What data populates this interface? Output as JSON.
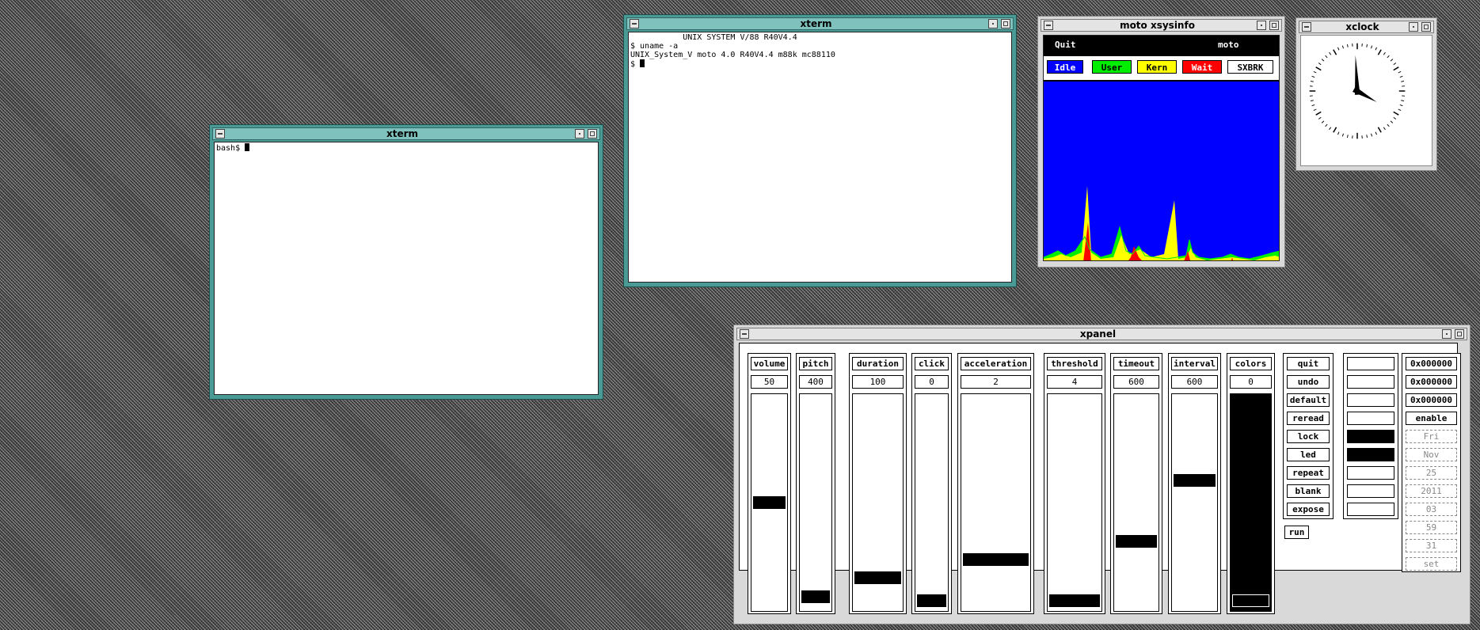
{
  "xterm_left": {
    "title": "xterm",
    "prompt": "bash$ "
  },
  "xterm_right": {
    "title": "xterm",
    "lines": [
      "           UNIX SYSTEM V/88 R40V4.4",
      "$ uname -a",
      "UNIX_System_V moto 4.0 R40V4.4 m88k mc88110",
      "$ "
    ]
  },
  "xsysinfo": {
    "title": "moto xsysinfo",
    "quit": "Quit",
    "host": "moto",
    "legend": [
      {
        "label": "Idle",
        "bg": "#0000ff",
        "fg": "#ffffff"
      },
      {
        "label": "User",
        "bg": "#00ee00",
        "fg": "#000000"
      },
      {
        "label": "Kern",
        "bg": "#ffff00",
        "fg": "#000000"
      },
      {
        "label": "Wait",
        "bg": "#ff0000",
        "fg": "#ffffff"
      },
      {
        "label": "SXBRK",
        "bg": "#ffffff",
        "fg": "#000000"
      }
    ]
  },
  "xclock": {
    "title": "xclock",
    "hours": 3,
    "minutes": 59,
    "seconds": 31
  },
  "xpanel": {
    "title": "xpanel",
    "sliders": [
      {
        "label": "volume",
        "value": "50",
        "level": 0.5
      },
      {
        "label": "pitch",
        "value": "400",
        "level": 0.04
      },
      {
        "label": "duration",
        "value": "100",
        "level": 0.13
      },
      {
        "label": "click",
        "value": "0",
        "level": 0.02
      },
      {
        "label": "acceleration",
        "value": "2",
        "level": 0.22
      },
      {
        "label": "threshold",
        "value": "4",
        "level": 0.02
      },
      {
        "label": "timeout",
        "value": "600",
        "level": 0.31
      },
      {
        "label": "interval",
        "value": "600",
        "level": 0.61
      },
      {
        "label": "colors",
        "value": "0",
        "level": 0.02
      }
    ],
    "buttons": [
      "quit",
      "undo",
      "default",
      "reread",
      "lock",
      "led",
      "repeat",
      "blank",
      "expose"
    ],
    "run": "run",
    "indicators": [
      false,
      false,
      false,
      false,
      true,
      true,
      false,
      false,
      false
    ],
    "hex_fields": [
      "0x000000",
      "0x000000",
      "0x000000"
    ],
    "enable": "enable",
    "date_fields": [
      "Fri",
      "Nov",
      "25",
      "2011",
      "03",
      "59",
      "31",
      "set"
    ]
  }
}
